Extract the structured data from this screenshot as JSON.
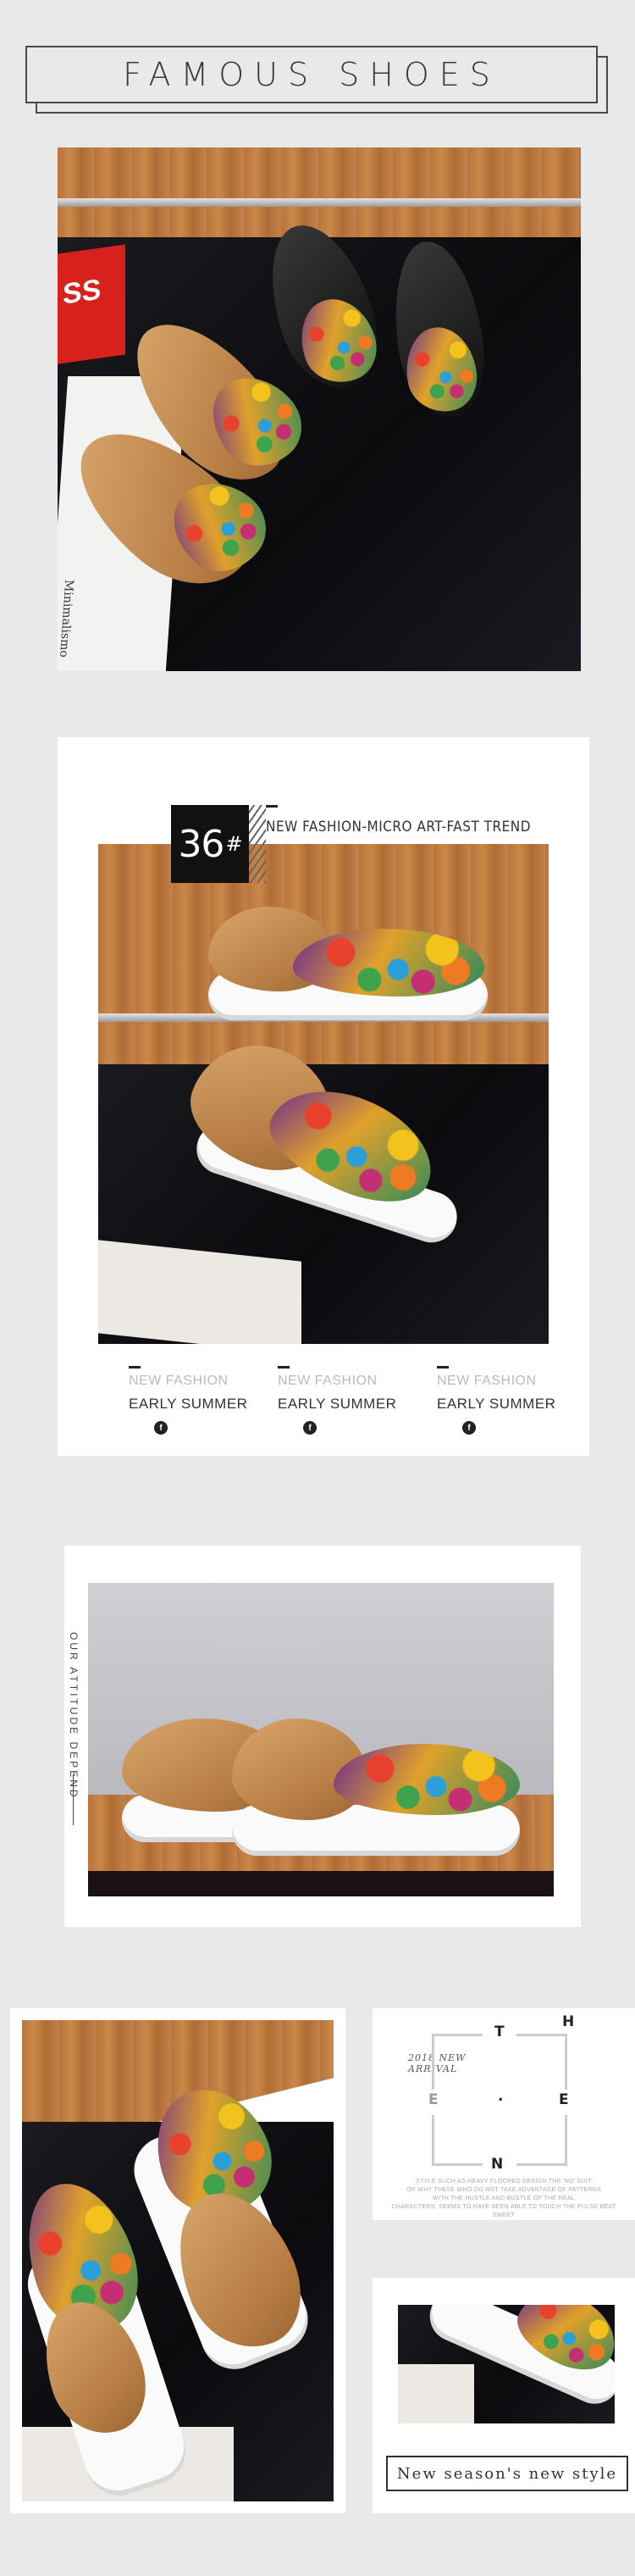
{
  "header": {
    "title": "FAMOUS SHOES"
  },
  "section1": {
    "box_letters": "SS",
    "book_text": "Minimalismo"
  },
  "section2": {
    "size_number": "36",
    "size_symbol": "#",
    "trend_text": "NEW FASHION-MICRO ART-FAST TREND",
    "features": [
      {
        "top": "NEW FASHION",
        "bottom": "EARLY SUMMER",
        "icon": "f"
      },
      {
        "top": "NEW FASHION",
        "bottom": "EARLY SUMMER",
        "icon": "f"
      },
      {
        "top": "NEW FASHION",
        "bottom": "EARLY SUMMER",
        "icon": "f"
      }
    ]
  },
  "section3": {
    "vertical_text": "OUR ATTITUDE DEPEND"
  },
  "section4": {
    "arrival_line1": "2018 NEW",
    "arrival_line2": "ARRIVAL",
    "letters": {
      "t": "T",
      "h": "H",
      "e_left": "E",
      "dot": ".",
      "e_right": "E",
      "n": "N"
    },
    "fine_print_1": "STYLE SUCH AS HEAVY FLOORED DESIGN THE 'NO' SUIT",
    "fine_print_2": "OR WHY THESE WHO DO NOT TAKE ADVANTAGE OF PATTERNS",
    "fine_print_3": "WITH THE HUSTLE AND BUSTLE OF THE REAL",
    "fine_print_4": "CHARACTERS: SEEMS TO HAVE BEEN ABLE TO TOUCH THE PULSE BEAT SWEET",
    "slogan": "New season's new style"
  },
  "colors": {
    "background": "#e9e9e9",
    "card": "#ffffff",
    "wood": "#c4814a",
    "dark_floor": "#111114"
  }
}
